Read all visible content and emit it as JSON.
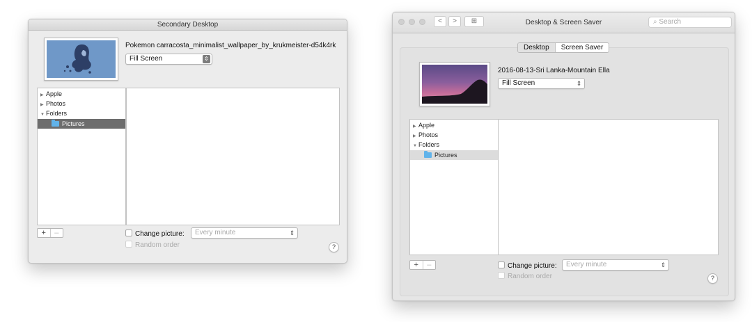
{
  "left_window": {
    "title": "Secondary Desktop",
    "wallpaper_name": "Pokemon carracosta_minimalist_wallpaper_by_krukmeister-d54k4rk",
    "fit_popup": "Fill Screen",
    "sources": [
      {
        "label": "Apple",
        "disclosure": "▶"
      },
      {
        "label": "Photos",
        "disclosure": "▶"
      },
      {
        "label": "Folders",
        "disclosure": "▼"
      }
    ],
    "selected_source": "Pictures",
    "add_label": "+",
    "remove_label": "–",
    "change_picture_label": "Change picture:",
    "interval_popup": "Every minute",
    "random_order_label": "Random order",
    "help_label": "?"
  },
  "right_window": {
    "title": "Desktop & Screen Saver",
    "search_placeholder": "Search",
    "back_label": "<",
    "forward_label": ">",
    "grid_icon": "⊞",
    "tabs": [
      "Desktop",
      "Screen Saver"
    ],
    "wallpaper_name": "2016-08-13-Sri Lanka-Mountain Ella",
    "fit_popup": "Fill Screen",
    "sources": [
      {
        "label": "Apple",
        "disclosure": "▶"
      },
      {
        "label": "Photos",
        "disclosure": "▶"
      },
      {
        "label": "Folders",
        "disclosure": "▼"
      }
    ],
    "selected_source": "Pictures",
    "add_label": "+",
    "remove_label": "–",
    "change_picture_label": "Change picture:",
    "interval_popup": "Every minute",
    "random_order_label": "Random order",
    "help_label": "?"
  },
  "colors": {
    "selection_gray": "#6d6d6d",
    "selection_light": "#dcdcdc",
    "folder_blue": "#61b3ea",
    "thumb_blue": "#6f98c8",
    "thumb_dusk_top": "#5a4a86",
    "thumb_dusk_mid": "#c46c9a"
  }
}
